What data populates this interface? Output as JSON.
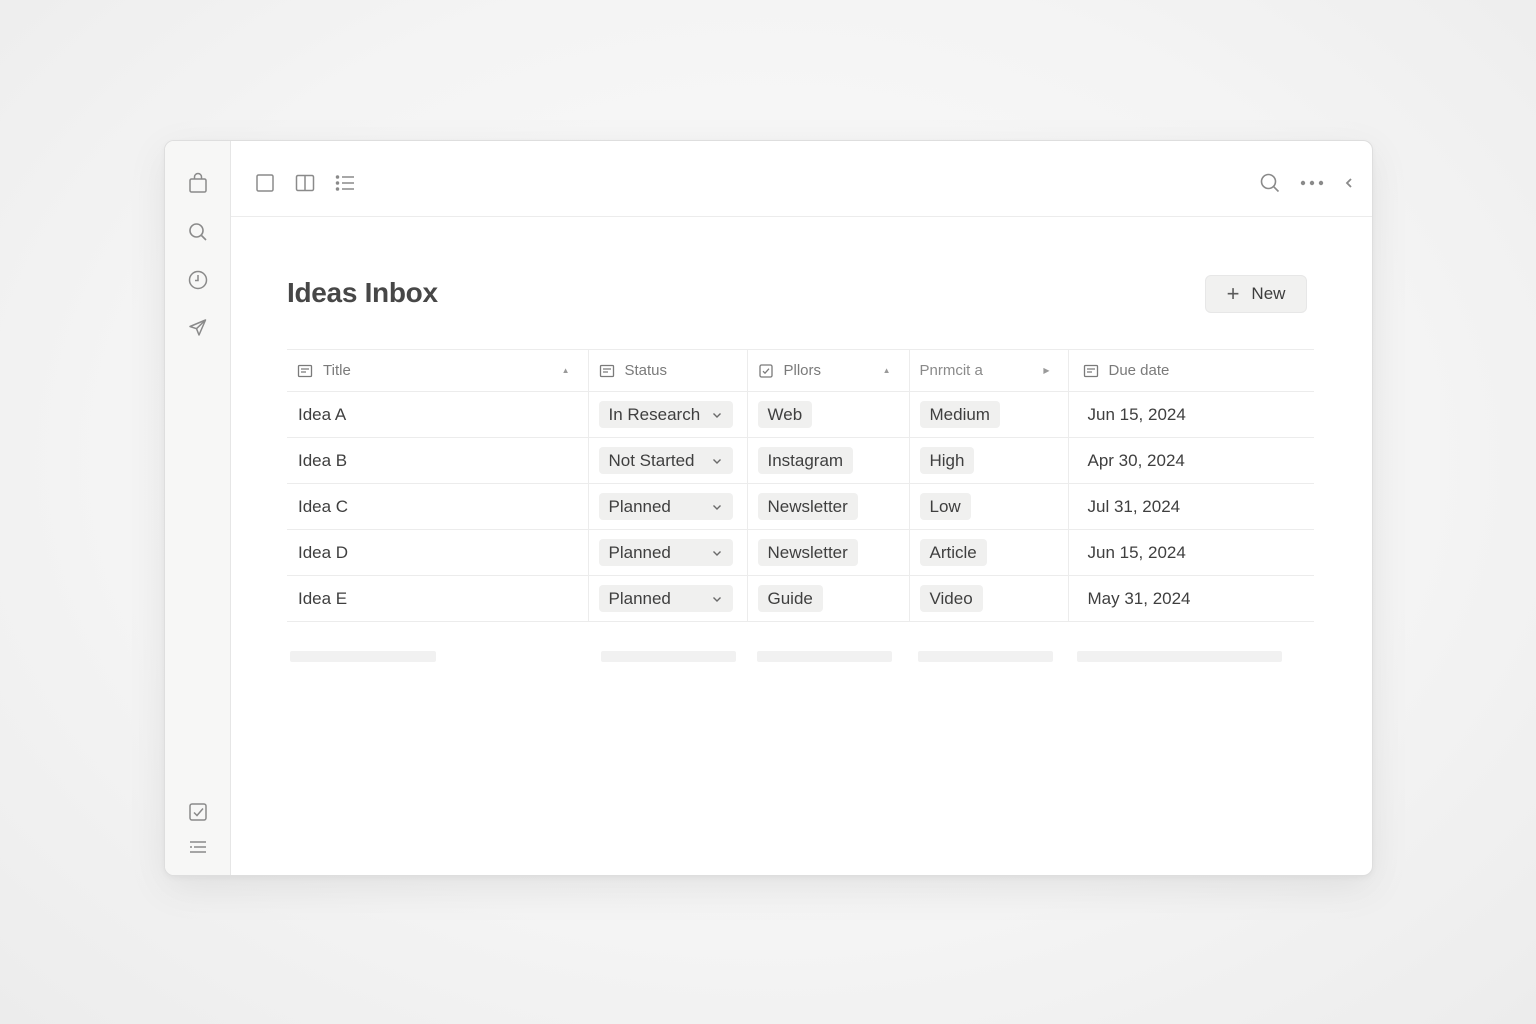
{
  "page": {
    "title": "Ideas Inbox"
  },
  "toolbar": {
    "new_label": "New"
  },
  "table": {
    "columns": [
      {
        "label": "Title",
        "icon": "text-property-icon"
      },
      {
        "label": "Status",
        "icon": "select-property-icon"
      },
      {
        "label": "Pllors",
        "icon": "multiselect-property-icon"
      },
      {
        "label": "Pnrmcit a",
        "icon": "select-property-icon"
      },
      {
        "label": "Due date",
        "icon": "date-property-icon"
      }
    ],
    "rows": [
      {
        "title": "Idea A",
        "status": "In Research",
        "pillar": "Web",
        "format": "Medium",
        "due": "Jun 15, 2024"
      },
      {
        "title": "Idea B",
        "status": "Not Started",
        "pillar": "Instagram",
        "format": "High",
        "due": "Apr 30, 2024"
      },
      {
        "title": "Idea C",
        "status": "Planned",
        "pillar": "Newsletter",
        "format": "Low",
        "due": "Jul 31, 2024"
      },
      {
        "title": "Idea D",
        "status": "Planned",
        "pillar": "Newsletter",
        "format": "Article",
        "due": "Jun 15, 2024"
      },
      {
        "title": "Idea E",
        "status": "Planned",
        "pillar": "Guide",
        "format": "Video",
        "due": "May 31, 2024"
      }
    ]
  },
  "icons": {
    "rail_top": [
      "bag-icon",
      "search-icon",
      "clock-icon",
      "send-icon"
    ],
    "rail_bottom": [
      "checkbox-icon",
      "list-settings-icon"
    ],
    "view_switcher": [
      "single-pane-icon",
      "split-pane-icon",
      "list-view-icon"
    ],
    "top_right": [
      "search-icon",
      "more-icon",
      "collapse-icon"
    ]
  },
  "colors": {
    "background": "#f3f3f3",
    "pill": "#f0f0ef",
    "text": "#3f3f3f",
    "muted": "#7a7a7a"
  }
}
